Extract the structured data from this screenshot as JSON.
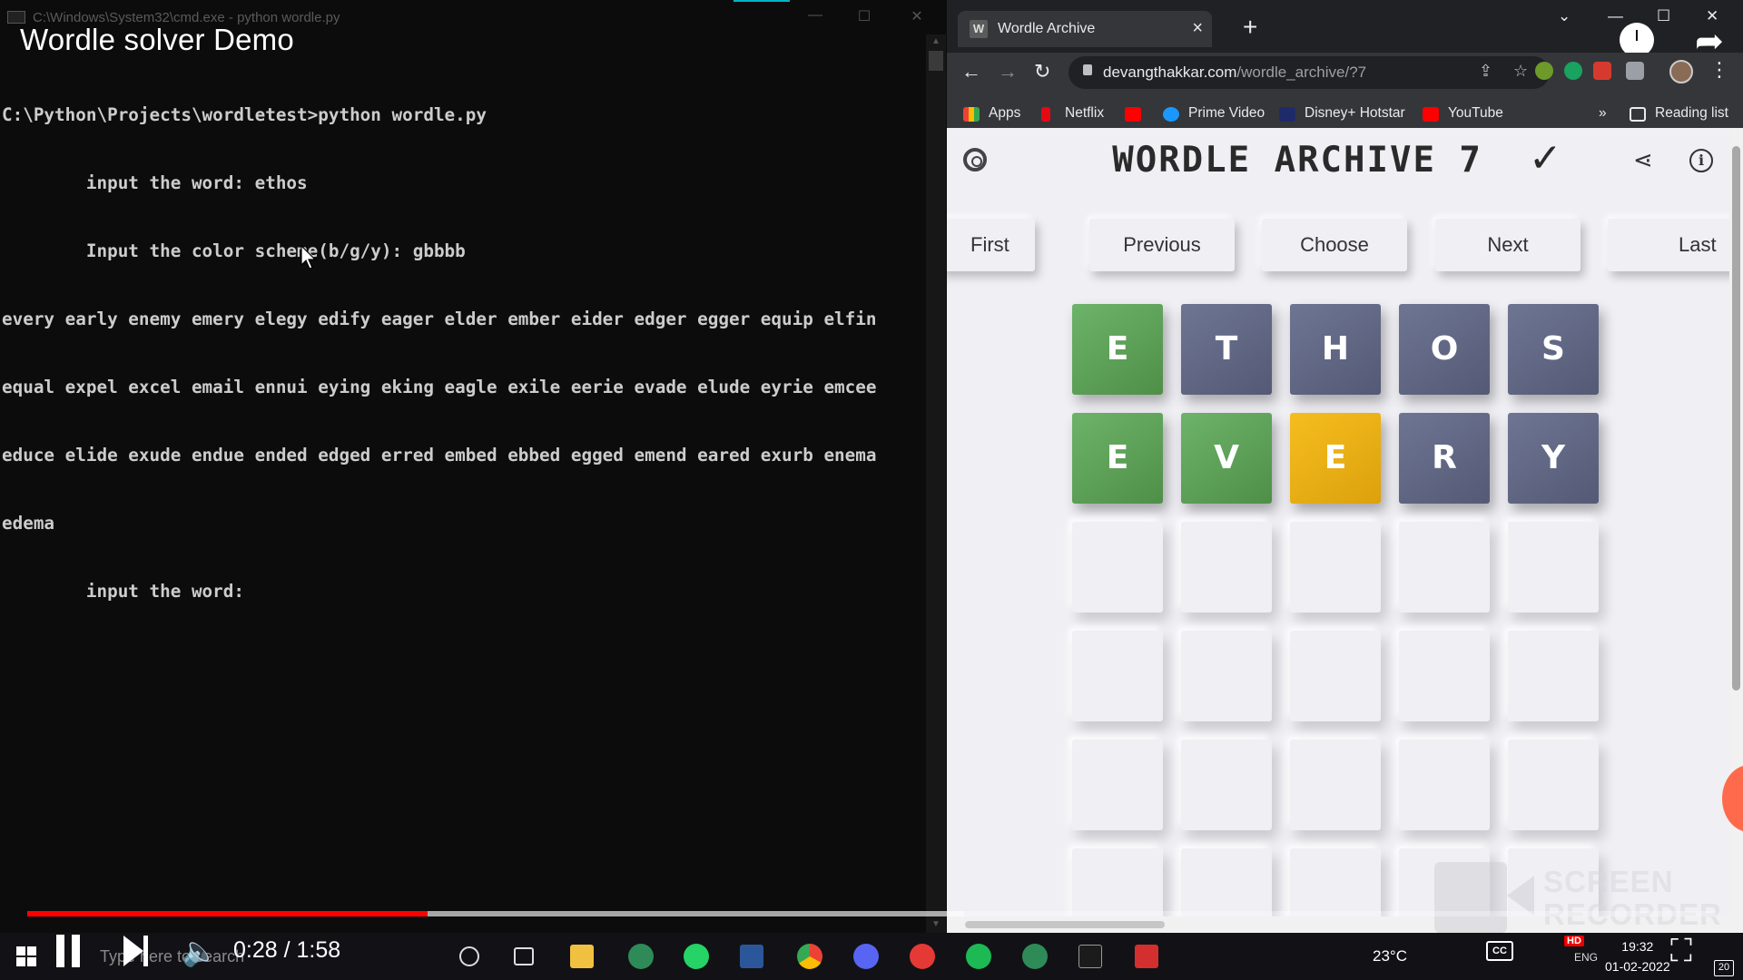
{
  "terminal": {
    "window_title": "C:\\Windows\\System32\\cmd.exe - python  wordle.py",
    "overlay_title": "Wordle solver Demo",
    "lines": [
      "C:\\Python\\Projects\\wordletest>python wordle.py",
      "        input the word: ethos",
      "        Input the color scheme(b/g/y): gbbbb",
      "every early enemy emery elegy edify eager elder ember eider edger egger equip elfin",
      "equal expel excel email ennui eying eking eagle exile eerie evade elude eyrie emcee",
      "educe elide exude endue ended edged erred embed ebbed egged emend eared exurb enema",
      "edema",
      "        input the word:"
    ]
  },
  "browser": {
    "tab_title": "Wordle Archive",
    "tab_favicon": "W",
    "url_host": "devangthakkar.com",
    "url_path": "/wordle_archive/?7",
    "bookmarks": [
      "Apps",
      "Netflix",
      "Prime Video",
      "Disney+ Hotstar",
      "YouTube"
    ],
    "reading_list": "Reading list"
  },
  "page": {
    "title": "WORDLE ARCHIVE 7",
    "check_mark": "✓",
    "nav_buttons": [
      "First",
      "Previous",
      "Choose",
      "Next",
      "Last"
    ],
    "rows": [
      [
        {
          "letter": "E",
          "state": "green"
        },
        {
          "letter": "T",
          "state": "gray"
        },
        {
          "letter": "H",
          "state": "gray"
        },
        {
          "letter": "O",
          "state": "gray"
        },
        {
          "letter": "S",
          "state": "gray"
        }
      ],
      [
        {
          "letter": "E",
          "state": "green"
        },
        {
          "letter": "V",
          "state": "green"
        },
        {
          "letter": "E",
          "state": "yellow"
        },
        {
          "letter": "R",
          "state": "gray"
        },
        {
          "letter": "Y",
          "state": "gray"
        }
      ],
      [
        {
          "letter": "",
          "state": "empty"
        },
        {
          "letter": "",
          "state": "empty"
        },
        {
          "letter": "",
          "state": "empty"
        },
        {
          "letter": "",
          "state": "empty"
        },
        {
          "letter": "",
          "state": "empty"
        }
      ],
      [
        {
          "letter": "",
          "state": "empty"
        },
        {
          "letter": "",
          "state": "empty"
        },
        {
          "letter": "",
          "state": "empty"
        },
        {
          "letter": "",
          "state": "empty"
        },
        {
          "letter": "",
          "state": "empty"
        }
      ],
      [
        {
          "letter": "",
          "state": "empty"
        },
        {
          "letter": "",
          "state": "empty"
        },
        {
          "letter": "",
          "state": "empty"
        },
        {
          "letter": "",
          "state": "empty"
        },
        {
          "letter": "",
          "state": "empty"
        }
      ],
      [
        {
          "letter": "",
          "state": "empty"
        },
        {
          "letter": "",
          "state": "empty"
        },
        {
          "letter": "",
          "state": "empty"
        },
        {
          "letter": "",
          "state": "empty"
        },
        {
          "letter": "",
          "state": "empty"
        }
      ]
    ],
    "colors": {
      "green": "#6aaa64",
      "gray": "#5f6683",
      "yellow": "#f0b41a"
    }
  },
  "watermark": {
    "line1": "SCREEN",
    "line2": "RECORDER"
  },
  "player": {
    "time": "0:28 / 1:58",
    "played_fraction": 0.2373,
    "loaded_fraction": 0.555,
    "quality_badge": "HD",
    "cc_label": "CC"
  },
  "taskbar": {
    "search_placeholder": "Type here to search",
    "weather": "23°C",
    "lang": "ENG",
    "clock_time": "19:32",
    "clock_date": "01-02-2022",
    "notifications": "20",
    "apps": [
      "cortana-icon",
      "task-view-icon",
      "file-explorer-icon",
      "app-green-icon",
      "whatsapp-icon",
      "word-icon",
      "chrome-icon",
      "discord-icon",
      "youtube-icon",
      "spotify-icon",
      "app-green2-icon",
      "terminal-icon",
      "recorder-icon"
    ]
  }
}
